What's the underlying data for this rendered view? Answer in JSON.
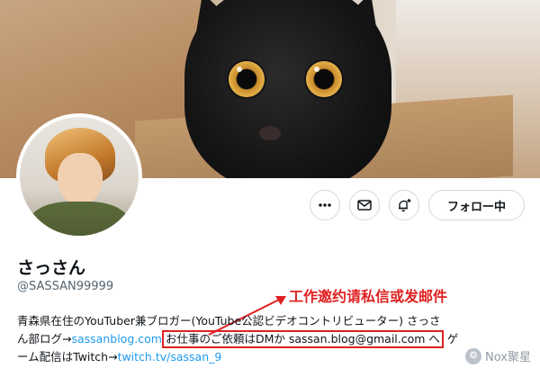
{
  "profile": {
    "display_name": "さっさん",
    "handle": "@SASSAN99999",
    "follow_button_label": "フォロー中"
  },
  "icons": {
    "more": "more-icon",
    "dm": "envelope-icon",
    "notify": "bell-plus-icon"
  },
  "bio": {
    "line1": "青森県在住のYouTuber兼ブロガー(YouTube公認ビデオコントリビューター) さっさ",
    "line2_prefix": "ん部ログ→",
    "line2_link": "sassanblog.com",
    "line2_highlight": "お仕事のご依頼はDMか sassan.blog@gmail.com へ",
    "line2_suffix": "ゲ",
    "line3_prefix": "ーム配信はTwitch→",
    "line3_link": "twitch.tv/sassan_9"
  },
  "annotation": {
    "text": "工作邀约请私信或发邮件"
  },
  "watermark": {
    "text": "Nox聚星"
  },
  "colors": {
    "link": "#1d9bf0",
    "annotation_red": "#e02020",
    "handle_gray": "#536471"
  }
}
